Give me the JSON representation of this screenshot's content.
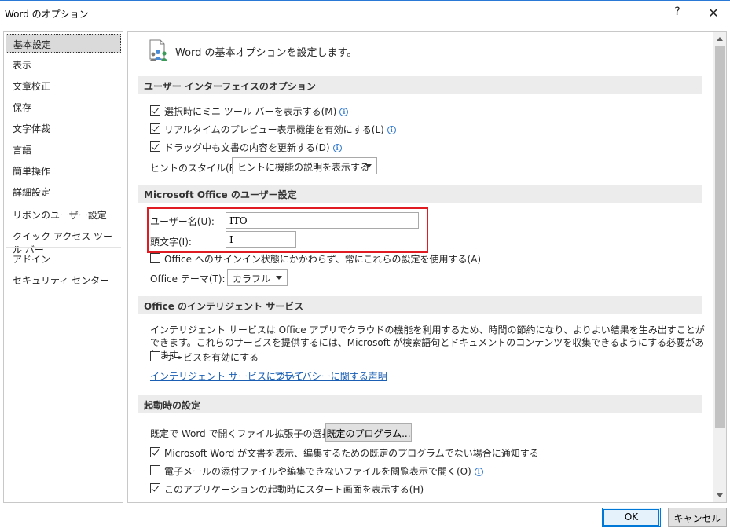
{
  "window": {
    "title": "Word のオプション",
    "help": "?",
    "close": "✕"
  },
  "sidebar": {
    "items": [
      {
        "label": "基本設定"
      },
      {
        "label": "表示"
      },
      {
        "label": "文章校正"
      },
      {
        "label": "保存"
      },
      {
        "label": "文字体裁"
      },
      {
        "label": "言語"
      },
      {
        "label": "簡単操作"
      },
      {
        "label": "詳細設定"
      },
      {
        "label": "リボンのユーザー設定"
      },
      {
        "label": "クイック アクセス ツール バー"
      },
      {
        "label": "アドイン"
      },
      {
        "label": "セキュリティ センター"
      }
    ],
    "selected": "基本設定"
  },
  "header": {
    "text": "Word の基本オプションを設定します。",
    "icon": "options-people-icon"
  },
  "ui_options": {
    "section_title": "ユーザー インターフェイスのオプション",
    "mini_toolbar": {
      "label": "選択時にミニ ツール バーを表示する(M)",
      "checked": true
    },
    "live_preview": {
      "label": "リアルタイムのプレビュー表示機能を有効にする(L)",
      "checked": true
    },
    "drag_update": {
      "label": "ドラッグ中も文書の内容を更新する(D)",
      "checked": true
    },
    "tooltip_style": {
      "label": "ヒントのスタイル(R):",
      "value": "ヒントに機能の説明を表示する"
    }
  },
  "user_settings": {
    "section_title": "Microsoft Office のユーザー設定",
    "username": {
      "label": "ユーザー名(U):",
      "value": "ITO"
    },
    "initials": {
      "label": "頭文字(I):",
      "value": "I"
    },
    "always_use": {
      "label": "Office へのサインイン状態にかかわらず、常にこれらの設定を使用する(A)",
      "checked": false
    },
    "theme": {
      "label": "Office テーマ(T):",
      "value": "カラフル"
    },
    "highlight_color": "#e11b22"
  },
  "intelligent": {
    "section_title": "Office のインテリジェント サービス",
    "description": "インテリジェント サービスは Office アプリでクラウドの機能を利用するため、時間の節約になり、よりよい結果を生み出すことができます。これらのサービスを提供するには、Microsoft が検索語句とドキュメントのコンテンツを収集できるようにする必要があります。",
    "enable": {
      "label": "サービスを有効にする",
      "checked": false
    },
    "link_about": "インテリジェント サービスについて",
    "link_privacy": "プライバシーに関する声明"
  },
  "startup": {
    "section_title": "起動時の設定",
    "ext_label": "既定で Word で開くファイル拡張子の選択:",
    "default_programs": "既定のプログラム...",
    "notify_default": {
      "label": "Microsoft Word が文書を表示、編集するための既定のプログラムでない場合に通知する",
      "checked": true
    },
    "open_attachments": {
      "label": "電子メールの添付ファイルや編集できないファイルを閲覧表示で開く(O)",
      "checked": false
    },
    "show_start": {
      "label": "このアプリケーションの起動時にスタート画面を表示する(H)",
      "checked": true
    }
  },
  "footer": {
    "ok": "OK",
    "cancel": "キャンセル"
  }
}
